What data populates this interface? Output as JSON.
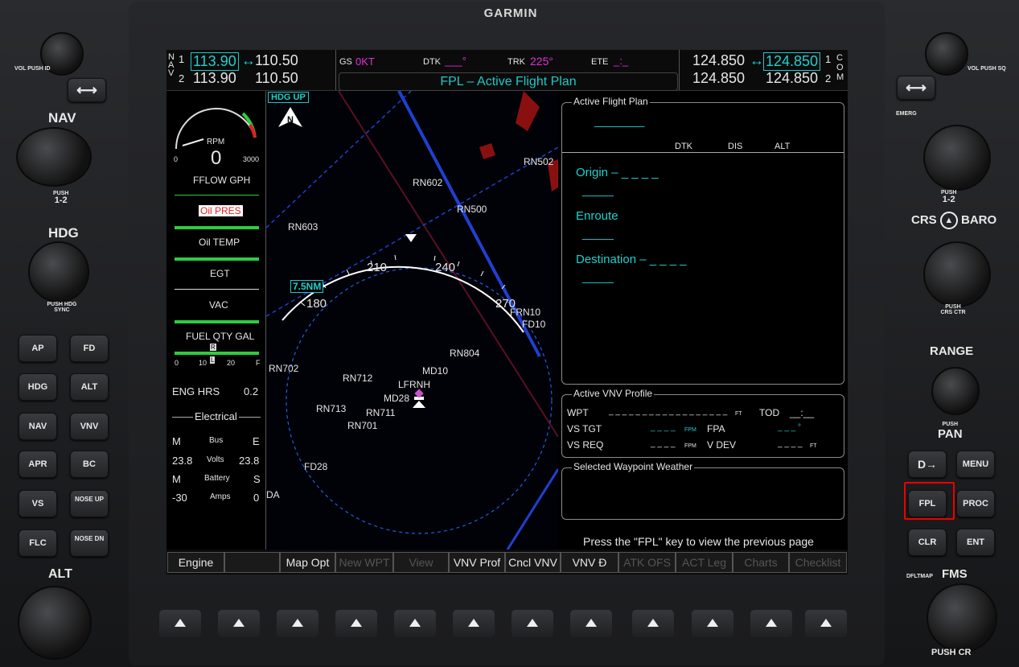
{
  "brand": "GARMIN",
  "nav": {
    "label_letters": [
      "N",
      "A",
      "V"
    ],
    "row1": {
      "idx": "1",
      "active": "113.90",
      "arrow": "↔",
      "standby": "110.50"
    },
    "row2": {
      "idx": "2",
      "active": "113.90",
      "standby": "110.50"
    }
  },
  "com": {
    "label_letters": [
      "C",
      "O",
      "M"
    ],
    "row1": {
      "idx": "1",
      "active": "124.850",
      "arrow": "↔",
      "standby": "124.850"
    },
    "row2": {
      "idx": "2",
      "active": "124.850",
      "standby": "124.850"
    }
  },
  "topfields": {
    "gs_label": "GS",
    "gs_value": "0KT",
    "dtk_label": "DTK",
    "dtk_value": "___°",
    "trk_label": "TRK",
    "trk_value": "225°",
    "ete_label": "ETE",
    "ete_value": "_:_"
  },
  "page_title": "FPL – Active Flight Plan",
  "engine": {
    "rpm_label": "RPM",
    "rpm_value": "0",
    "rpm_min": "0",
    "rpm_max": "3000",
    "fflow_label": "FFLOW GPH",
    "oilpres_label": "Oil PRES",
    "oiltemp_label": "Oil TEMP",
    "egt_label": "EGT",
    "vac_label": "VAC",
    "fuel_label": "FUEL QTY GAL",
    "fuel_ticks": [
      "0",
      "10",
      "20",
      "F"
    ],
    "fuel_markers": [
      "R",
      "L"
    ],
    "eng_hrs_label": "ENG HRS",
    "eng_hrs_value": "0.2",
    "electrical_label": "Electrical",
    "bus_left": "M",
    "bus_label": "Bus",
    "bus_right": "E",
    "volts_left": "23.8",
    "volts_label": "Volts",
    "volts_right": "23.8",
    "batt_left": "M",
    "batt_label": "Battery",
    "batt_right": "S",
    "amps_left": "-30",
    "amps_label": "Amps",
    "amps_right": "0"
  },
  "map": {
    "orientation": "HDG UP",
    "north_label": "N",
    "range": "7.5NM",
    "compass": [
      "180",
      "210",
      "240",
      "270"
    ],
    "waypoints": [
      "RN502",
      "RN602",
      "RN500",
      "RN603",
      "FRN10",
      "FD10",
      "RN804",
      "MD10",
      "RN702",
      "RN712",
      "LFRNH",
      "MD28",
      "RN713",
      "RN711",
      "RN701",
      "FD28"
    ],
    "edge_label": "DA"
  },
  "fpl": {
    "title": "Active Flight Plan",
    "name_dash": "________",
    "col_dtk": "DTK",
    "col_dis": "DIS",
    "col_alt": "ALT",
    "origin": "Origin –",
    "origin_dash": "_ _ _ _",
    "enroute": "Enroute",
    "destination": "Destination –",
    "destination_dash": "_ _ _ _",
    "leg_dash": "_____"
  },
  "vnv": {
    "title": "Active VNV Profile",
    "wpt_label": "WPT",
    "wpt_value": "_ _ _ _ _ _ _ _ _ _ _ _ _ _ _ _ _ _",
    "ft1": "FT",
    "tod_label": "TOD",
    "tod_value": "__:__",
    "vstgt_label": "VS TGT",
    "vstgt_value": "_ _ _ _",
    "fpm1": "FPM",
    "fpa_label": "FPA",
    "fpa_value": "_ _ _ °",
    "vsreq_label": "VS REQ",
    "vsreq_value": "_ _ _ _",
    "fpm2": "FPM",
    "vdev_label": "V DEV",
    "vdev_value": "_ _ _ _",
    "ft2": "FT"
  },
  "weather": {
    "title": "Selected Waypoint Weather"
  },
  "hint": "Press the \"FPL\" key to view the previous page",
  "softkeys": [
    {
      "label": "Engine",
      "disabled": false
    },
    {
      "label": "",
      "disabled": false
    },
    {
      "label": "Map Opt",
      "disabled": false
    },
    {
      "label": "New WPT",
      "disabled": true
    },
    {
      "label": "View",
      "disabled": true
    },
    {
      "label": "VNV Prof",
      "disabled": false
    },
    {
      "label": "Cncl VNV",
      "disabled": false
    },
    {
      "label": "VNV Đ",
      "disabled": false
    },
    {
      "label": "ATK OFS",
      "disabled": true
    },
    {
      "label": "ACT Leg",
      "disabled": true
    },
    {
      "label": "Charts",
      "disabled": true
    },
    {
      "label": "Checklist",
      "disabled": true
    }
  ],
  "left_controls": {
    "vol_label": "VOL",
    "vol_push": "PUSH ID",
    "nav_label": "NAV",
    "nav_push": "PUSH",
    "nav_push2": "1-2",
    "hdg_label": "HDG",
    "hdg_push": "PUSH HDG SYNC",
    "alt_label": "ALT",
    "buttons": [
      [
        "AP",
        "FD"
      ],
      [
        "HDG",
        "ALT"
      ],
      [
        "NAV",
        "VNV"
      ],
      [
        "APR",
        "BC"
      ],
      [
        "VS",
        "NOSE UP"
      ],
      [
        "FLC",
        "NOSE DN"
      ]
    ]
  },
  "right_controls": {
    "vol_label": "VOL",
    "vol_push": "PUSH SQ",
    "emerg_label": "EMERG",
    "com_push": "PUSH",
    "com_push2": "1-2",
    "crs_label": "CRS",
    "baro_label": "BARO",
    "crs_push": "PUSH CRS CTR",
    "range_label": "RANGE",
    "pan_push": "PUSH",
    "pan_label": "PAN",
    "dflt_label": "DFLTMAP",
    "fms_label": "FMS",
    "fms_push": "PUSH CR",
    "buttons": [
      [
        "D→",
        "MENU"
      ],
      [
        "FPL",
        "PROC"
      ],
      [
        "CLR",
        "ENT"
      ]
    ]
  }
}
